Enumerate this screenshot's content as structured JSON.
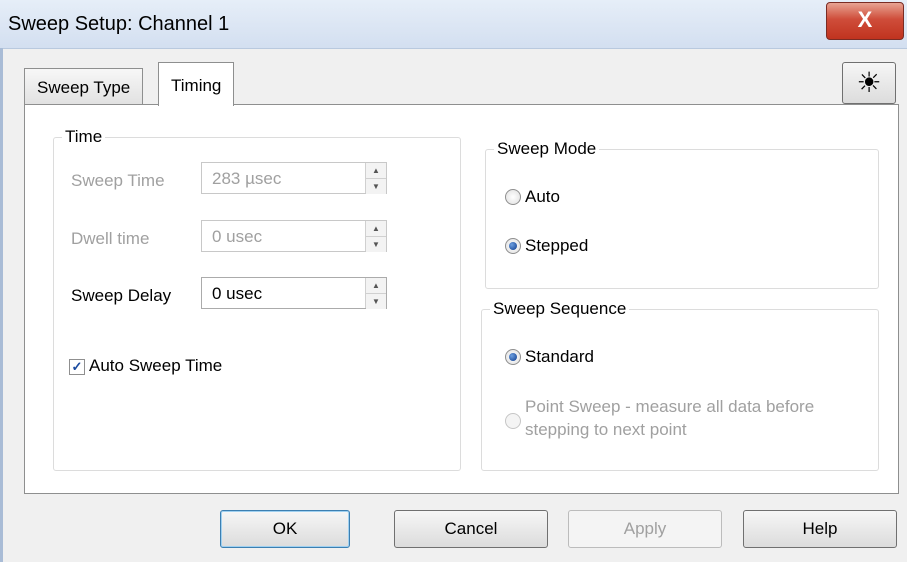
{
  "window": {
    "title": "Sweep Setup: Channel 1",
    "close_glyph": "X"
  },
  "tabs": [
    {
      "label": "Sweep Type",
      "active": false
    },
    {
      "label": "Timing",
      "active": true
    }
  ],
  "toolbar": {
    "display_icon": "sun-icon",
    "display_glyph": "☀"
  },
  "time_group": {
    "legend": "Time",
    "sweep_time": {
      "label": "Sweep Time",
      "value": "283 µsec",
      "enabled": false
    },
    "dwell_time": {
      "label": "Dwell time",
      "value": "0 usec",
      "enabled": false
    },
    "sweep_delay": {
      "label": "Sweep Delay",
      "value": "0 usec",
      "enabled": true
    },
    "auto_sweep_time": {
      "label": "Auto Sweep Time",
      "checked": true,
      "check_glyph": "✓"
    }
  },
  "sweep_mode": {
    "legend": "Sweep Mode",
    "options": [
      {
        "label": "Auto",
        "selected": false
      },
      {
        "label": "Stepped",
        "selected": true
      }
    ]
  },
  "sweep_sequence": {
    "legend": "Sweep Sequence",
    "standard": {
      "label": "Standard",
      "selected": true
    },
    "point_sweep": {
      "label_line1": "Point Sweep - measure all data before",
      "label_line2": "stepping to next point",
      "selected": false,
      "enabled": false
    }
  },
  "spin": {
    "up": "▲",
    "down": "▼"
  },
  "buttons": {
    "ok": "OK",
    "cancel": "Cancel",
    "apply": "Apply",
    "help": "Help"
  },
  "colors": {
    "title_gradient_top": "#e6eef8",
    "close_red": "#c0331f",
    "disabled_text": "#a0a0a0",
    "radio_blue": "#0c3a8c"
  }
}
